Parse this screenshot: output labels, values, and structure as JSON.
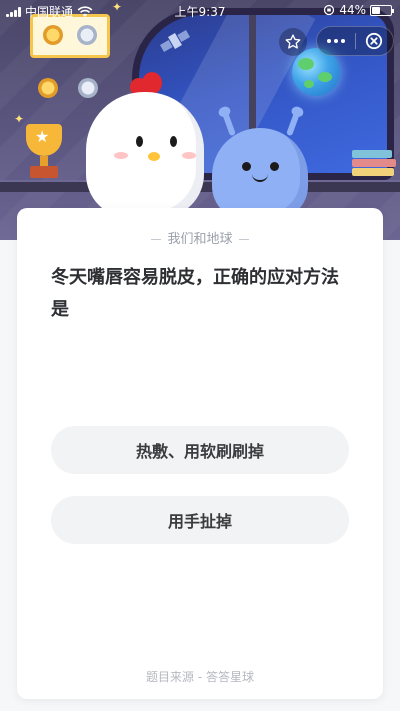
{
  "status_bar": {
    "carrier": "中国联通",
    "time": "上午9:37",
    "battery": "44%",
    "battery_level": 0.44
  },
  "header": {
    "favorite_icon": "star-outline-icon",
    "more_icon": "more-dots-icon",
    "close_icon": "close-circle-icon"
  },
  "card": {
    "category": "我们和地球",
    "question": "冬天嘴唇容易脱皮，正确的应对方法是",
    "options": [
      {
        "label": "热敷、用软刷刷掉"
      },
      {
        "label": "用手扯掉"
      }
    ],
    "source": "题目来源 - 答答星球"
  },
  "colors": {
    "hero_bg": "#4a4668",
    "card_bg": "#ffffff",
    "option_bg": "#f2f3f5",
    "accent_gold": "#f5c54c"
  }
}
